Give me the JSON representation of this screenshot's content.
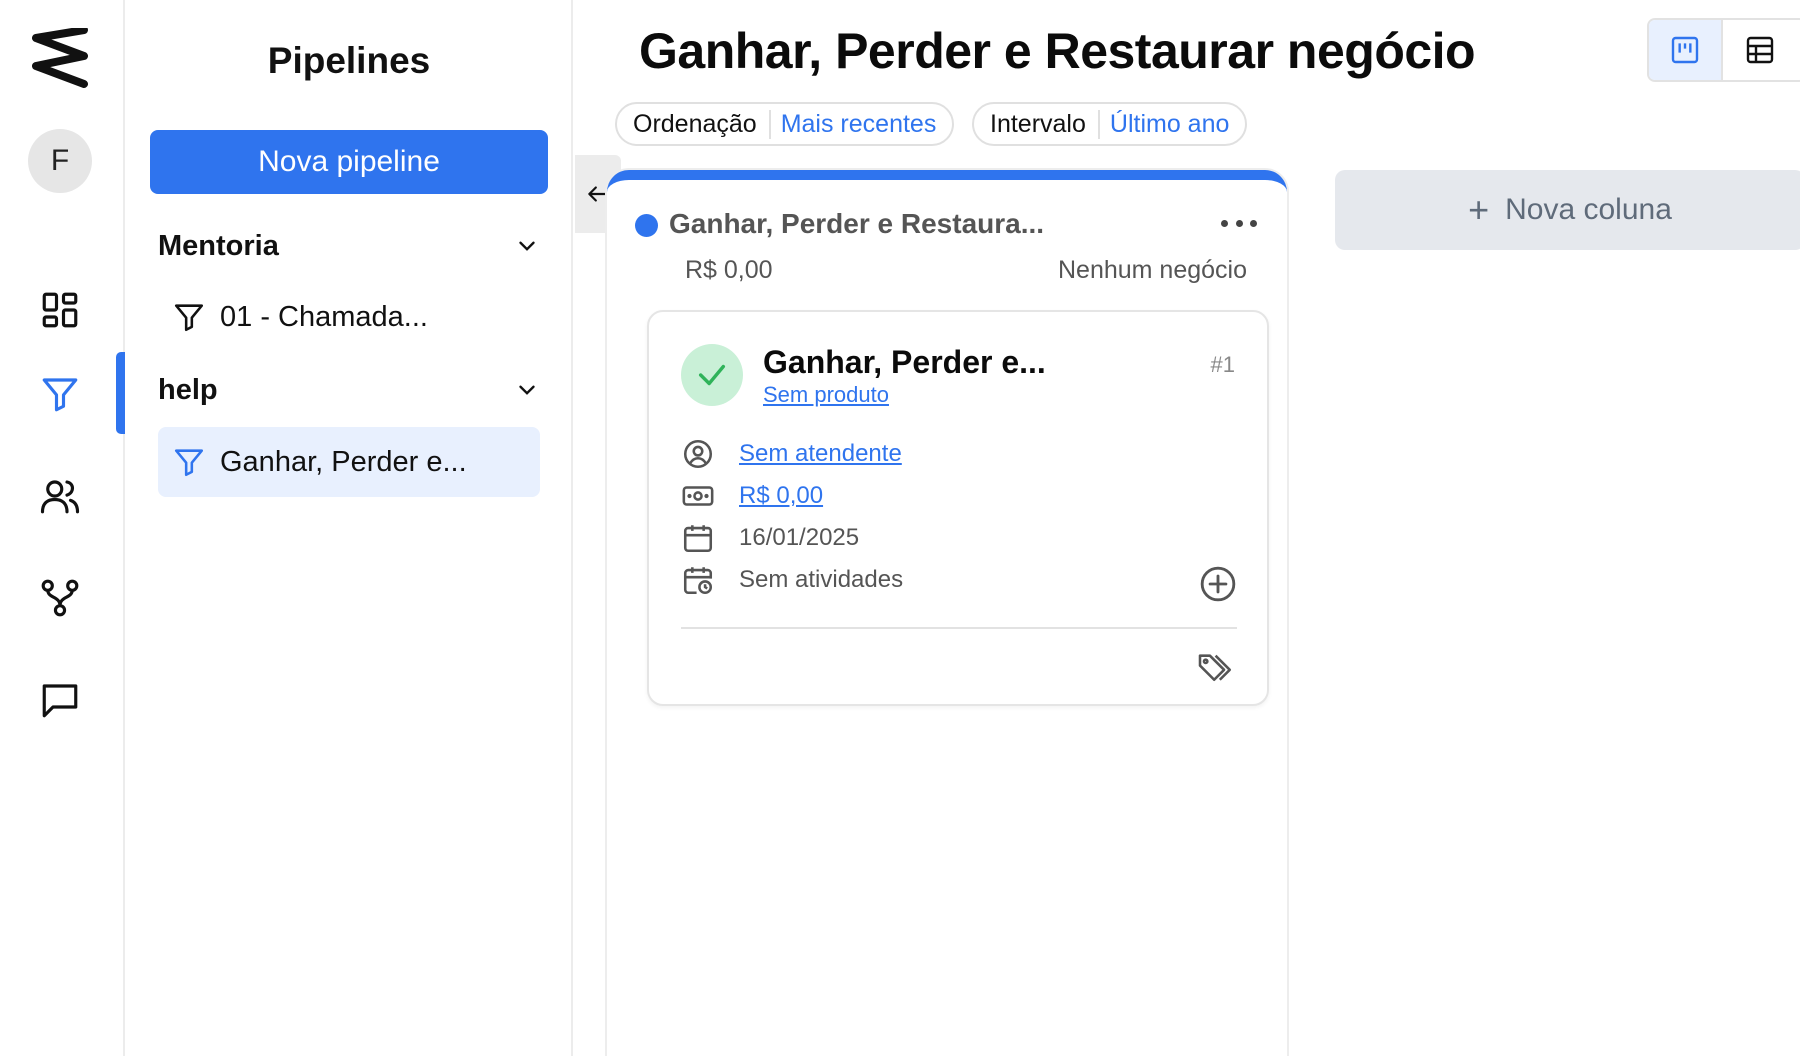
{
  "rail": {
    "avatar_initial": "F",
    "icons": [
      "logo-icon",
      "dashboard-icon",
      "funnel-icon",
      "users-icon",
      "workflow-icon",
      "chat-icon"
    ]
  },
  "sidebar": {
    "title": "Pipelines",
    "new_button": "Nova pipeline",
    "groups": [
      {
        "label": "Mentoria",
        "items": [
          {
            "label": "01 - Chamada..."
          }
        ]
      },
      {
        "label": "help",
        "items": [
          {
            "label": "Ganhar, Perder e...",
            "selected": true
          }
        ]
      }
    ]
  },
  "header": {
    "title": "Ganhar, Perder e Restaurar negócio",
    "filters": [
      {
        "key": "Ordenação",
        "value": "Mais recentes"
      },
      {
        "key": "Intervalo",
        "value": "Último ano"
      }
    ]
  },
  "column": {
    "title": "Ganhar, Perder e Restaura...",
    "total": "R$ 0,00",
    "count": "Nenhum negócio",
    "accent": "#2f74ee"
  },
  "card": {
    "title": "Ganhar, Perder e...",
    "id": "#1",
    "product": "Sem produto",
    "attendant": "Sem atendente",
    "value": "R$ 0,00",
    "date": "16/01/2025",
    "activities": "Sem atividades",
    "status_color": "#2fb35a"
  },
  "new_column": {
    "label": "Nova coluna"
  },
  "colors": {
    "primary": "#2f74ee",
    "success_bg": "#c9f0d7",
    "muted": "#555555"
  }
}
